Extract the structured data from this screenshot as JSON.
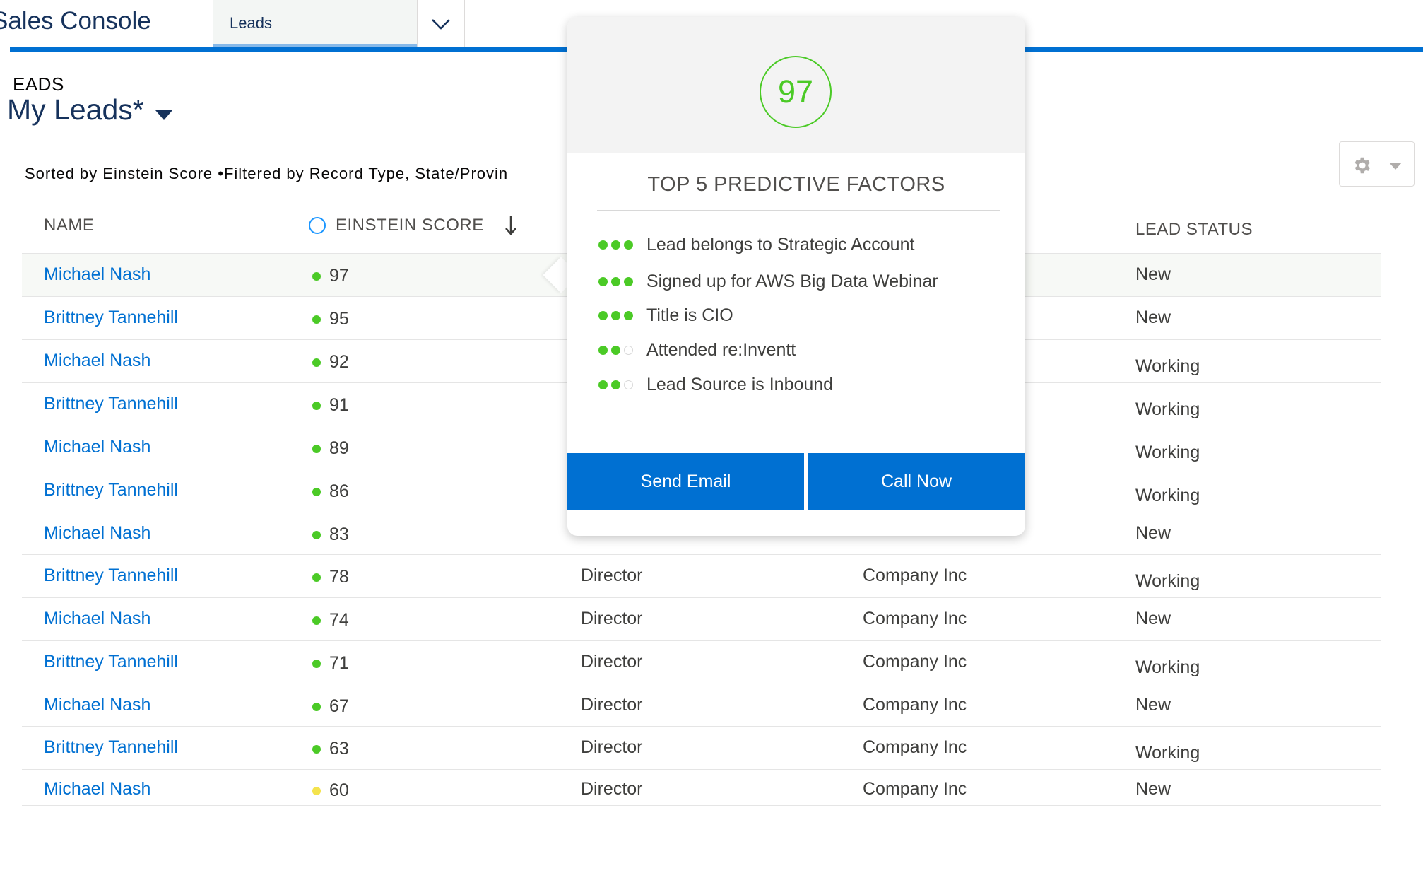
{
  "app": {
    "name": "Sales Console"
  },
  "nav": {
    "tab_label": "Leads"
  },
  "header": {
    "object_label": "EADS",
    "list_view_title": "My Leads*",
    "sort_filter_info": "Sorted by Einstein Score •Filtered by Record Type, State/Provin"
  },
  "table": {
    "columns": {
      "name": "NAME",
      "score": "EINSTEIN SCORE",
      "status": "LEAD STATUS"
    },
    "rows": [
      {
        "name": "Michael Nash",
        "score": "97",
        "score_color": "#4bca26",
        "title": "",
        "company": "",
        "status": "New"
      },
      {
        "name": "Brittney Tannehill",
        "score": "95",
        "score_color": "#4bca26",
        "title": "",
        "company": "",
        "status": "New"
      },
      {
        "name": "Michael Nash",
        "score": "92",
        "score_color": "#4bca26",
        "title": "",
        "company": "",
        "status": "Working"
      },
      {
        "name": "Brittney Tannehill",
        "score": "91",
        "score_color": "#4bca26",
        "title": "",
        "company": "",
        "status": "Working"
      },
      {
        "name": "Michael Nash",
        "score": "89",
        "score_color": "#4bca26",
        "title": "",
        "company": "",
        "status": "Working"
      },
      {
        "name": "Brittney Tannehill",
        "score": "86",
        "score_color": "#4bca26",
        "title": "",
        "company": "",
        "status": "Working"
      },
      {
        "name": "Michael Nash",
        "score": "83",
        "score_color": "#4bca26",
        "title": "",
        "company": "",
        "status": "New"
      },
      {
        "name": "Brittney Tannehill",
        "score": "78",
        "score_color": "#4bca26",
        "title": "Director",
        "company": "Company Inc",
        "status": "Working"
      },
      {
        "name": "Michael Nash",
        "score": "74",
        "score_color": "#4bca26",
        "title": "Director",
        "company": "Company Inc",
        "status": "New"
      },
      {
        "name": "Brittney Tannehill",
        "score": "71",
        "score_color": "#4bca26",
        "title": "Director",
        "company": "Company Inc",
        "status": "Working"
      },
      {
        "name": "Michael Nash",
        "score": "67",
        "score_color": "#4bca26",
        "title": "Director",
        "company": "Company Inc",
        "status": "New"
      },
      {
        "name": "Brittney Tannehill",
        "score": "63",
        "score_color": "#4bca26",
        "title": "Director",
        "company": "Company Inc",
        "status": "Working"
      },
      {
        "name": "Michael Nash",
        "score": "60",
        "score_color": "#f4e34d",
        "title": "Director",
        "company": "Company Inc",
        "status": "New"
      }
    ]
  },
  "popover": {
    "score": "97",
    "score_color": "#4bca26",
    "title": "TOP 5 PREDICTIVE FACTORS",
    "factors": [
      {
        "label": "Lead belongs to Strategic Account",
        "strength": 3
      },
      {
        "label": "Signed up for AWS Big Data Webinar",
        "strength": 3
      },
      {
        "label": "Title is CIO",
        "strength": 3
      },
      {
        "label": "Attended re:Inventt",
        "strength": 2
      },
      {
        "label": "Lead Source is Inbound",
        "strength": 2
      }
    ],
    "send_email_label": "Send Email",
    "call_now_label": "Call Now"
  },
  "colors": {
    "brand_blue": "#0070d2",
    "link": "#0070d2",
    "score_green": "#4bca26",
    "score_yellow": "#f4e34d"
  },
  "icons": {
    "tab_menu": "chevron-down-icon",
    "sort": "arrow-down-icon",
    "settings": "gear-icon"
  }
}
